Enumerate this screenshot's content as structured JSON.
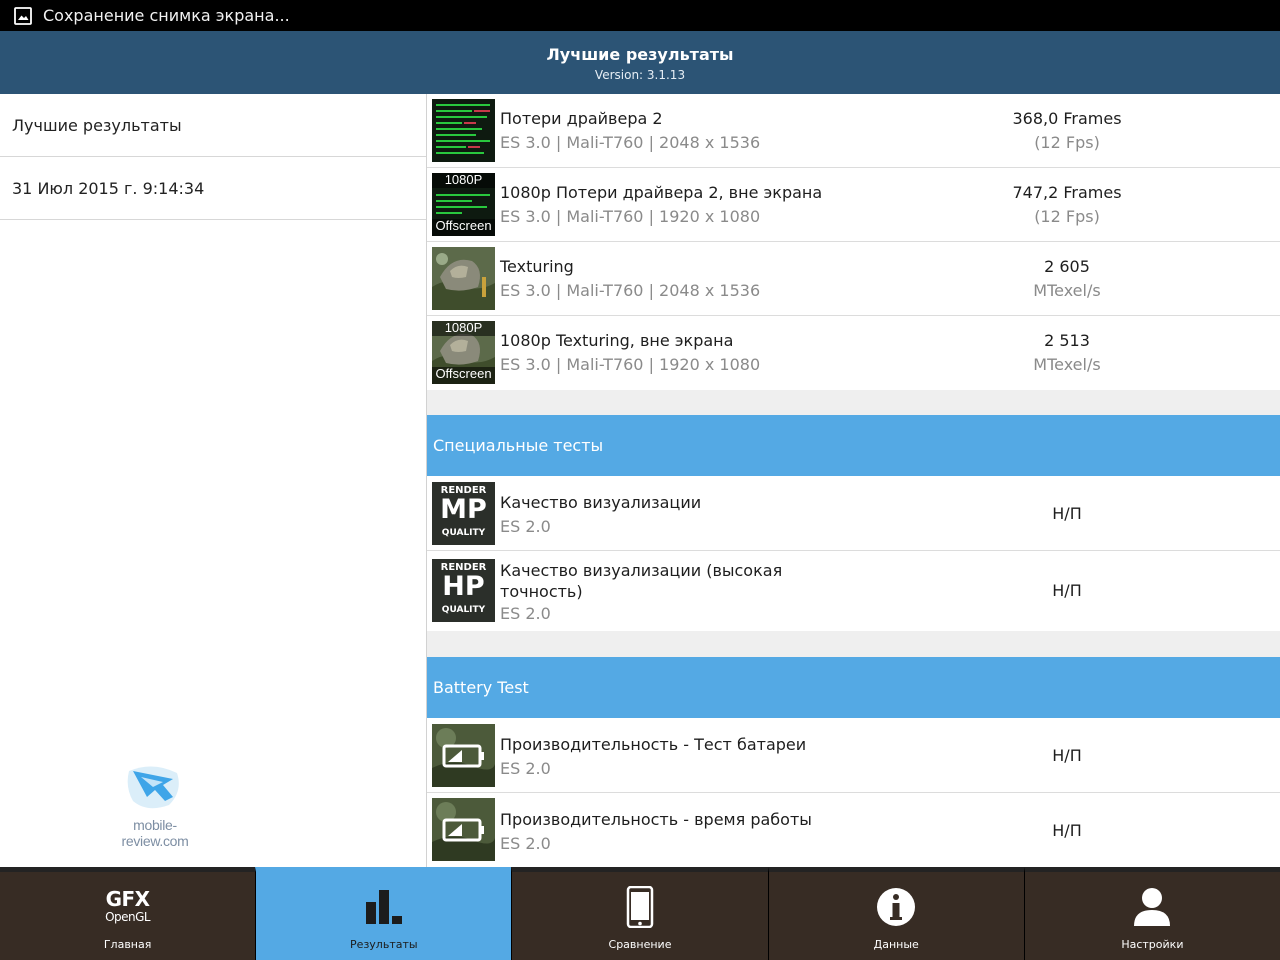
{
  "status_bar": {
    "text": "Сохранение снимка экрана..."
  },
  "header": {
    "title": "Лучшие результаты",
    "version": "Version: 3.1.13"
  },
  "sidebar": {
    "items": [
      {
        "label": "Лучшие результаты"
      },
      {
        "label": "31 Июл 2015 г. 9:14:34"
      }
    ]
  },
  "watermark": {
    "text": "mobile-review.com"
  },
  "results": [
    {
      "name": "Потери драйвера 2",
      "sub": "ES 3.0 | Mali-T760 | 2048 x 1536",
      "value": "368,0 Frames",
      "unit": "(12 Fps)"
    },
    {
      "name": "1080p Потери драйвера 2, вне экрана",
      "sub": "ES 3.0 | Mali-T760 | 1920 x 1080",
      "value": "747,2 Frames",
      "unit": "(12 Fps)",
      "badge_top": "1080P",
      "badge_bottom": "Offscreen"
    },
    {
      "name": "Texturing",
      "sub": "ES 3.0 | Mali-T760 | 2048 x 1536",
      "value": "2 605",
      "unit": "MTexel/s"
    },
    {
      "name": "1080p Texturing, вне экрана",
      "sub": "ES 3.0 | Mali-T760 | 1920 x 1080",
      "value": "2 513",
      "unit": "MTexel/s",
      "badge_top": "1080P",
      "badge_bottom": "Offscreen"
    }
  ],
  "special_section": {
    "title": "Специальные тесты",
    "items": [
      {
        "name": "Качество визуализации",
        "sub": "ES 2.0",
        "value": "Н/П",
        "badge": {
          "top": "RENDER",
          "big": "MP",
          "bottom": "QUALITY"
        }
      },
      {
        "name_line1": "Качество визуализации (высокая",
        "name_line2": "точность)",
        "sub": "ES 2.0",
        "value": "Н/П",
        "badge": {
          "top": "RENDER",
          "big": "HP",
          "bottom": "QUALITY"
        }
      }
    ]
  },
  "battery_section": {
    "title": "Battery Test",
    "items": [
      {
        "name": "Производительность - Тест батареи",
        "sub": "ES 2.0",
        "value": "Н/П"
      },
      {
        "name": "Производительность - время работы",
        "sub": "ES 2.0",
        "value": "Н/П"
      }
    ]
  },
  "bottom_nav": {
    "logo_top": "GFX",
    "logo_bottom": "OpenGL",
    "tabs": [
      {
        "label": "Главная",
        "icon": "gfx-logo-icon"
      },
      {
        "label": "Результаты",
        "icon": "bar-chart-icon",
        "active": true
      },
      {
        "label": "Сравнение",
        "icon": "phone-icon"
      },
      {
        "label": "Данные",
        "icon": "info-icon"
      },
      {
        "label": "Настройки",
        "icon": "user-icon"
      }
    ]
  },
  "colors": {
    "header_bg": "#2c5475",
    "section_bg": "#54a9e4",
    "nav_bg": "#372c24",
    "nav_active": "#54a9e4"
  }
}
